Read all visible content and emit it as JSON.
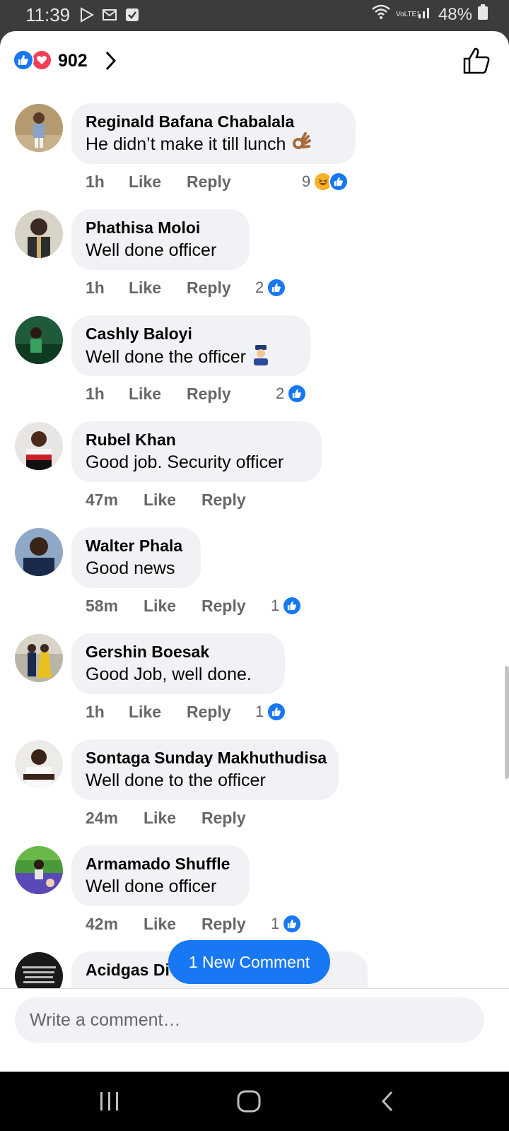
{
  "status_bar": {
    "time": "11:39",
    "network": "VoLTE1",
    "battery": "48%"
  },
  "reactions": {
    "count": "902"
  },
  "comments": [
    {
      "name": "Reginald Bafana Chabalala",
      "text": "He didn’t make it till lunch",
      "time": "1h",
      "like": "Like",
      "reply": "Reply",
      "reaction_count": "9"
    },
    {
      "name": "Phathisa Moloi",
      "text": "Well done officer",
      "time": "1h",
      "like": "Like",
      "reply": "Reply",
      "reaction_count": "2"
    },
    {
      "name": "Cashly Baloyi",
      "text": "Well done the officer",
      "time": "1h",
      "like": "Like",
      "reply": "Reply",
      "reaction_count": "2"
    },
    {
      "name": "Rubel Khan",
      "text": "Good job. Security officer",
      "time": "47m",
      "like": "Like",
      "reply": "Reply"
    },
    {
      "name": "Walter Phala",
      "text": "Good news",
      "time": "58m",
      "like": "Like",
      "reply": "Reply",
      "reaction_count": "1"
    },
    {
      "name": "Gershin Boesak",
      "text": "Good Job, well done.",
      "time": "1h",
      "like": "Like",
      "reply": "Reply",
      "reaction_count": "1"
    },
    {
      "name": "Sontaga Sunday Makhuthudisa",
      "text": "Well done to the officer",
      "time": "24m",
      "like": "Like",
      "reply": "Reply"
    },
    {
      "name": "Armamado Shuffle",
      "text": "Well done officer",
      "time": "42m",
      "like": "Like",
      "reply": "Reply",
      "reaction_count": "1"
    },
    {
      "name": "Acidgas Di"
    }
  ],
  "new_comment_pill": "1 New Comment",
  "composer": {
    "placeholder": "Write a comment…"
  },
  "colors": {
    "accent": "#1877f2",
    "bubble": "#f0f2f5",
    "muted_text": "#65676b",
    "love": "#f33e58"
  }
}
